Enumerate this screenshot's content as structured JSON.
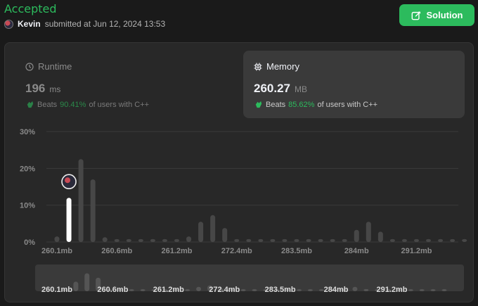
{
  "header": {
    "status": "Accepted",
    "user_name": "Kevin",
    "submitted_text": "submitted at Jun 12, 2024 13:53",
    "solution_label": "Solution"
  },
  "runtime": {
    "label": "Runtime",
    "value": "196",
    "unit": "ms",
    "beats_label": "Beats",
    "beats_pct": "90.41%",
    "beats_suffix": "of users with C++"
  },
  "memory": {
    "label": "Memory",
    "value": "260.27",
    "unit": "MB",
    "beats_label": "Beats",
    "beats_pct": "85.62%",
    "beats_suffix": "of users with C++"
  },
  "colors": {
    "accent_green": "#2cbb5d",
    "bar_gray": "#474747",
    "bar_highlight": "#ffffff",
    "grid": "#3a3a3a"
  },
  "chart_data": {
    "type": "bar",
    "yticks": [
      "30%",
      "20%",
      "10%",
      "0%"
    ],
    "yticks_values": [
      30,
      20,
      10,
      0
    ],
    "ylim": [
      0,
      30
    ],
    "xticks": [
      "260.1mb",
      "260.6mb",
      "261.2mb",
      "272.4mb",
      "283.5mb",
      "284mb",
      "291.2mb"
    ],
    "xtick_bar_index": [
      0,
      5,
      10,
      15,
      20,
      25,
      30
    ],
    "values": [
      1.5,
      12,
      22.5,
      17,
      1.3,
      0.8,
      0.8,
      0.8,
      0.8,
      0.8,
      0.8,
      1.5,
      5.5,
      7.3,
      3.8,
      0.8,
      0.8,
      0.8,
      0.8,
      0.8,
      0.8,
      0.8,
      0.8,
      0.8,
      0.8,
      3.3,
      5.5,
      2.8,
      0.8,
      0.8,
      0.8,
      0.8,
      0.8,
      0.8,
      0.8
    ],
    "highlight_index": 1,
    "overview": {
      "xticks": [
        "260.1mb",
        "260.6mb",
        "261.2mb",
        "272.4mb",
        "283.5mb",
        "284mb",
        "291.2mb"
      ]
    }
  }
}
